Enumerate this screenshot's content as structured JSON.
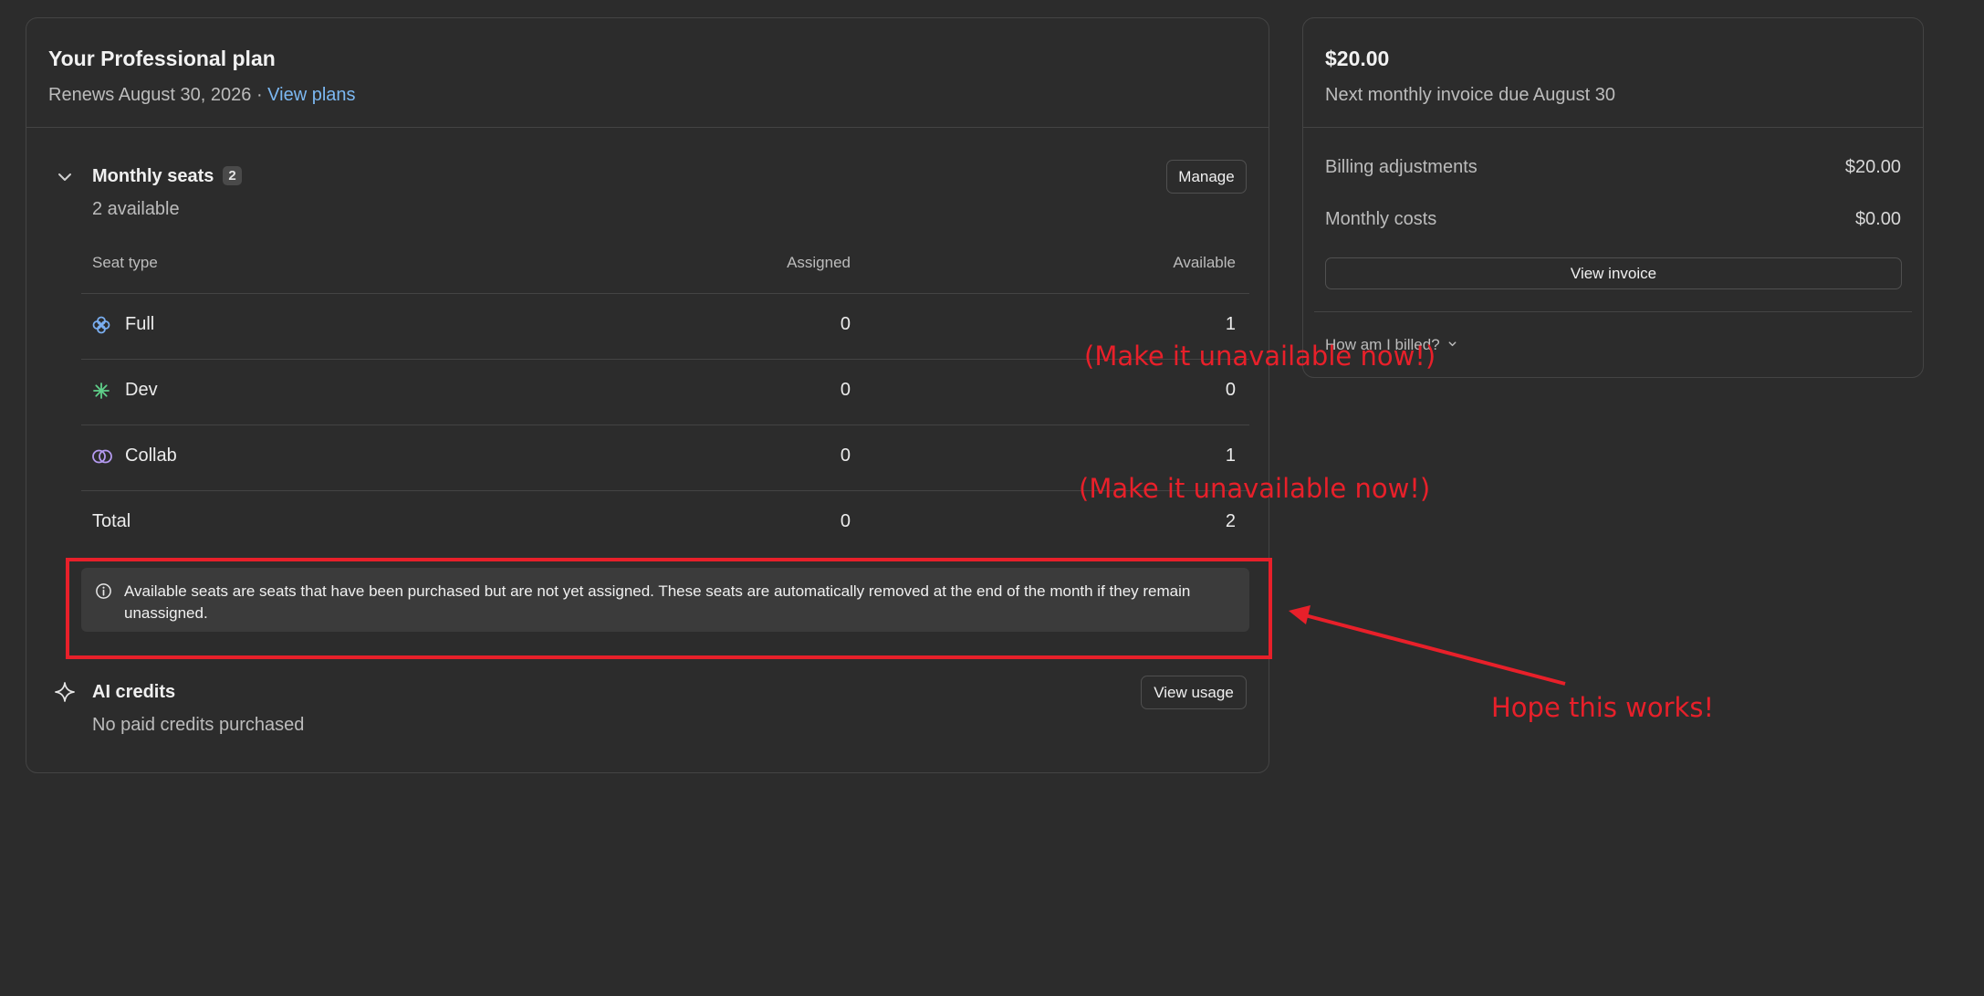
{
  "plan": {
    "title": "Your Professional plan",
    "renews": "Renews August 30, 2026 · ",
    "view_plans": "View plans"
  },
  "seats": {
    "title": "Monthly seats",
    "count_badge": "2",
    "available_text": "2 available",
    "manage_label": "Manage",
    "headers": {
      "seat_type": "Seat type",
      "assigned": "Assigned",
      "available": "Available"
    },
    "rows": [
      {
        "type": "Full",
        "assigned": "0",
        "available": "1",
        "icon": "full-seat-icon",
        "color": "#7aaef0"
      },
      {
        "type": "Dev",
        "assigned": "0",
        "available": "0",
        "icon": "dev-seat-icon",
        "color": "#5fd08a"
      },
      {
        "type": "Collab",
        "assigned": "0",
        "available": "1",
        "icon": "collab-seat-icon",
        "color": "#b49af0"
      }
    ],
    "total": {
      "label": "Total",
      "assigned": "0",
      "available": "2"
    },
    "info_text": "Available seats are seats that have been purchased but are not yet assigned. These seats are automatically removed at the end of the month if they remain unassigned."
  },
  "ai_credits": {
    "title": "AI credits",
    "status": "No paid credits purchased",
    "view_usage_label": "View usage"
  },
  "invoice": {
    "amount": "$20.00",
    "due": "Next monthly invoice due August 30",
    "billing_adjustments_label": "Billing adjustments",
    "billing_adjustments_value": "$20.00",
    "monthly_costs_label": "Monthly costs",
    "monthly_costs_value": "$0.00",
    "view_invoice_label": "View invoice",
    "how_billed": "How am I billed?"
  },
  "annotations": {
    "note_1": "(Make it unavailable now!)",
    "note_2": "(Make it unavailable now!)",
    "note_3": "Hope this works!",
    "color": "#e8202a"
  }
}
